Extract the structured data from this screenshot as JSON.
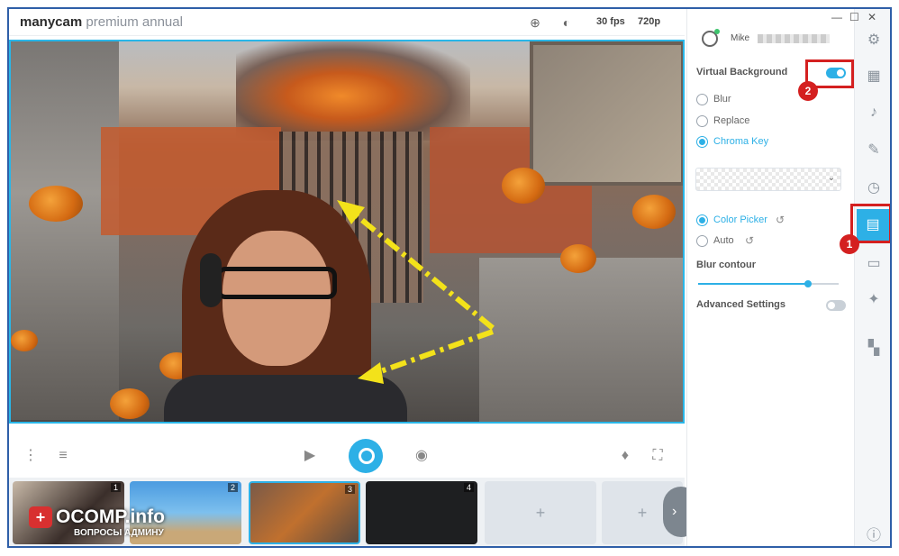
{
  "app": {
    "brand_bold": "manycam",
    "brand_light": " premium annual"
  },
  "titlebar": {
    "fps": "30 fps",
    "resolution": "720p"
  },
  "window_controls": {
    "minimize": "—",
    "maximize": "☐",
    "close": "✕"
  },
  "user": {
    "name": "Mike"
  },
  "panel": {
    "virtual_background_label": "Virtual Background",
    "virtual_background_enabled": true,
    "options": [
      {
        "label": "Blur",
        "selected": false
      },
      {
        "label": "Replace",
        "selected": false
      },
      {
        "label": "Chroma Key",
        "selected": true
      }
    ],
    "color_modes": [
      {
        "label": "Color Picker",
        "selected": true
      },
      {
        "label": "Auto",
        "selected": false
      }
    ],
    "blur_contour_label": "Blur contour",
    "blur_contour_value": 0.78,
    "advanced_settings_label": "Advanced Settings",
    "advanced_settings_enabled": false
  },
  "thumbnails": [
    {
      "number": "1"
    },
    {
      "number": "2"
    },
    {
      "number": "3",
      "selected": true
    },
    {
      "number": "4"
    },
    {
      "add": "+"
    },
    {
      "add": "+"
    }
  ],
  "annotations": {
    "badge1": "1",
    "badge2": "2"
  },
  "watermark": {
    "title": "OCOMP.info",
    "subtitle": "ВОПРОСЫ АДМИНУ",
    "logo": "+"
  },
  "colors": {
    "accent": "#2db0e6",
    "highlight_red": "#d42020",
    "arrow_yellow": "#f3e21a"
  }
}
